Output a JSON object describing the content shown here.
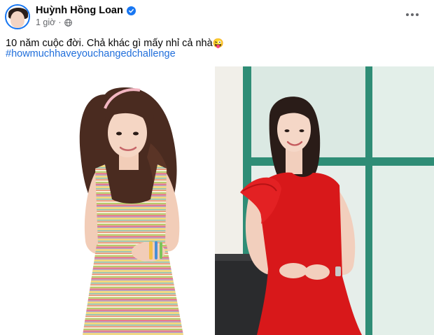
{
  "post": {
    "author": {
      "name": "Huỳnh Hồng Loan",
      "verified": true
    },
    "timestamp": "1 giờ",
    "privacy_icon": "globe-icon",
    "more_icon": "more-options-icon",
    "text": "10 năm cuộc đời. Chả khác gì mấy nhỉ cả nhà",
    "emoji": "😜",
    "hashtag": "#howmuchhaveyouchangedchallenge",
    "photos": [
      {
        "subject": "young woman in striped dress with hairband",
        "background": "white"
      },
      {
        "subject": "woman in red ruffled dress by window",
        "background": "indoor room with window"
      }
    ]
  },
  "colors": {
    "link": "#216fdb",
    "verified": "#1877f2",
    "secondary_text": "#65676b",
    "dress_red": "#d8181a"
  }
}
